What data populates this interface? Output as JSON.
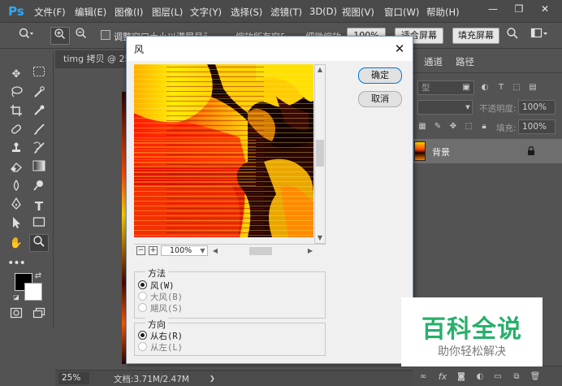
{
  "app": {
    "logo": "Ps"
  },
  "menu": {
    "items": [
      "文件(F)",
      "编辑(E)",
      "图像(I)",
      "图层(L)",
      "文字(Y)",
      "选择(S)",
      "滤镜(T)",
      "3D(D)",
      "视图(V)",
      "窗口(W)",
      "帮助(H)"
    ]
  },
  "window_controls": {
    "minimize": "—",
    "restore": "❐",
    "close": "✕"
  },
  "options": {
    "resize_windows_label": "调整窗口大小以满屏显示",
    "zoom_all_label": "缩放所有窗口",
    "scrubby_zoom_label": "细微缩放",
    "zoom_pct_button": "100%",
    "fit_screen_button": "适合屏幕",
    "fill_screen_button": "填充屏幕"
  },
  "document": {
    "tab_title": "timg 拷贝 @ 25%"
  },
  "status": {
    "zoom": "25%",
    "doc_info": "文档:3.71M/2.47M",
    "arrow": "❯"
  },
  "right_panel": {
    "tabs": [
      "通道",
      "路径"
    ],
    "kind_label": "型",
    "opacity_label": "不透明度:",
    "opacity_value": "100%",
    "fill_label": "填充:",
    "fill_value": "100%",
    "layer_name": "背景"
  },
  "dialog": {
    "title": "风",
    "ok_button": "确定",
    "cancel_button": "取消",
    "preview_zoom": "100%",
    "method_group": {
      "label": "方法",
      "options": [
        "风(W)",
        "大风(B)",
        "飓风(S)"
      ],
      "selected": "风(W)"
    },
    "direction_group": {
      "label": "方向",
      "options": [
        "从右(R)",
        "从左(L)"
      ],
      "selected": "从右(R)"
    }
  },
  "watermark": {
    "title": "百科全说",
    "subtitle": "助你轻松解决"
  },
  "colors": {
    "accent": "#31a8ff",
    "dialog_bg": "#f0f0f0",
    "watermark_green": "#27b06b"
  }
}
